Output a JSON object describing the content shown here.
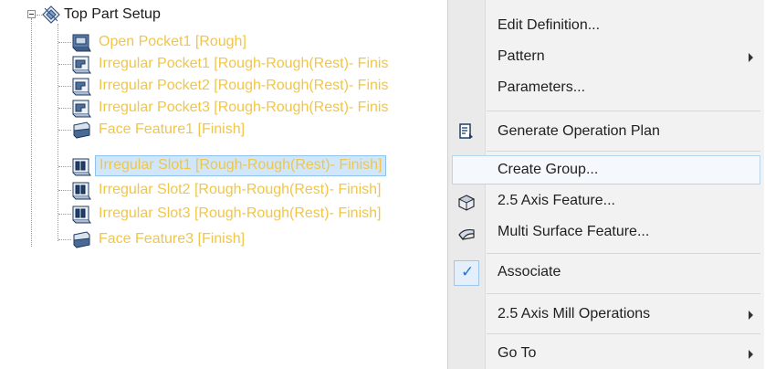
{
  "tree": {
    "root_label": "Top Part Setup",
    "items": [
      {
        "label": "Open Pocket1 [Rough]",
        "icon": "open-pocket-icon"
      },
      {
        "label": "Irregular Pocket1 [Rough-Rough(Rest)- Finis",
        "icon": "irregular-pocket-icon"
      },
      {
        "label": "Irregular Pocket2 [Rough-Rough(Rest)- Finis",
        "icon": "irregular-pocket-icon"
      },
      {
        "label": "Irregular Pocket3 [Rough-Rough(Rest)- Finis",
        "icon": "irregular-pocket-icon"
      },
      {
        "label": "Face Feature1 [Finish]",
        "icon": "face-feature-icon"
      },
      {
        "label": "Irregular Slot1 [Rough-Rough(Rest)- Finish]",
        "icon": "irregular-slot-icon",
        "selected": true
      },
      {
        "label": "Irregular Slot2 [Rough-Rough(Rest)- Finish]",
        "icon": "irregular-slot-icon"
      },
      {
        "label": "Irregular Slot3 [Rough-Rough(Rest)- Finish]",
        "icon": "irregular-slot-icon"
      },
      {
        "label": "Face Feature3 [Finish]",
        "icon": "face-feature-icon"
      }
    ]
  },
  "menu": {
    "items": [
      {
        "label": "Edit Definition..."
      },
      {
        "label": "Pattern",
        "submenu": true
      },
      {
        "label": "Parameters..."
      },
      {
        "label": "Generate Operation Plan",
        "icon": "operation-plan-icon"
      },
      {
        "label": "Create Group...",
        "hovered": true
      },
      {
        "label": "2.5 Axis Feature...",
        "icon": "axis-feature-icon"
      },
      {
        "label": "Multi Surface Feature...",
        "icon": "multi-surface-icon"
      },
      {
        "label": "Associate",
        "checked": true,
        "icon": "checkmark-icon"
      },
      {
        "label": "2.5 Axis Mill Operations",
        "submenu": true
      },
      {
        "label": "Go To",
        "submenu": true
      }
    ]
  },
  "colors": {
    "tree_label": "#f0c64a",
    "selection": "#cfe6fb",
    "menu_bg": "#f2f2f2",
    "check": "#2a6ed3"
  }
}
